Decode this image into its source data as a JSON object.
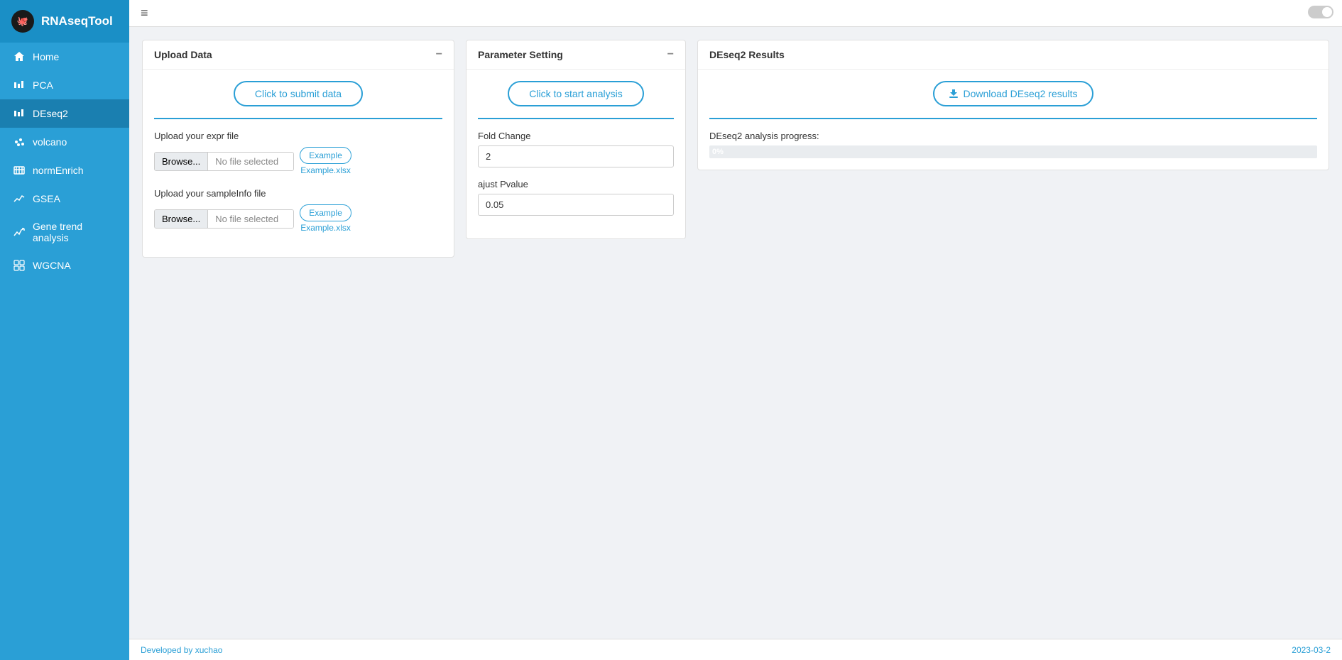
{
  "app": {
    "title": "RNAseqTool",
    "brand_icon": "🐙"
  },
  "toggle": {
    "state": false
  },
  "sidebar": {
    "items": [
      {
        "id": "home",
        "label": "Home",
        "icon": "home",
        "active": false
      },
      {
        "id": "pca",
        "label": "PCA",
        "icon": "pca",
        "active": false
      },
      {
        "id": "deseq2",
        "label": "DEseq2",
        "icon": "deseq2",
        "active": true
      },
      {
        "id": "volcano",
        "label": "volcano",
        "icon": "volcano",
        "active": false
      },
      {
        "id": "normEnrich",
        "label": "normEnrich",
        "icon": "normEnrich",
        "active": false
      },
      {
        "id": "gsea",
        "label": "GSEA",
        "icon": "gsea",
        "active": false
      },
      {
        "id": "gene-trend",
        "label": "Gene trend analysis",
        "icon": "trend",
        "active": false
      },
      {
        "id": "wgcna",
        "label": "WGCNA",
        "icon": "wgcna",
        "active": false
      }
    ]
  },
  "header": {
    "hamburger": "≡"
  },
  "upload_panel": {
    "title": "Upload Data",
    "submit_btn": "Click to submit data",
    "expr_file_label": "Upload your expr file",
    "expr_browse_label": "Browse...",
    "expr_no_file": "No file selected",
    "expr_example_btn": "Example",
    "expr_example_link": "Example.xlsx",
    "sample_file_label": "Upload your sampleInfo file",
    "sample_browse_label": "Browse...",
    "sample_no_file": "No file selected",
    "sample_example_btn": "Example",
    "sample_example_link": "Example.xlsx"
  },
  "param_panel": {
    "title": "Parameter Setting",
    "start_btn": "Click to start analysis",
    "fold_change_label": "Fold Change",
    "fold_change_value": "2",
    "pvalue_label": "ajust Pvalue",
    "pvalue_value": "0.05"
  },
  "results_panel": {
    "title": "DEseq2 Results",
    "download_btn": "Download DEseq2 results",
    "progress_label": "DEseq2 analysis progress:",
    "progress_value": 0,
    "progress_text": "0%"
  },
  "footer": {
    "left": "Developed by xuchao",
    "right": "2023-03-2"
  }
}
